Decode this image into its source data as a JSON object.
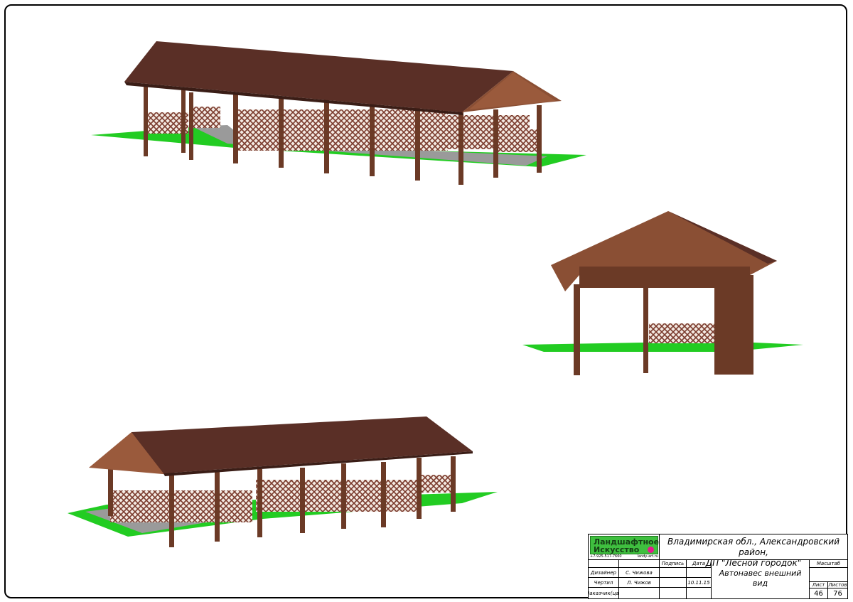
{
  "company": {
    "logo_line1": "Ландшафтное",
    "logo_line2": "Искусство",
    "phone": "+7-925-517-7660",
    "site": "landy-art.ru"
  },
  "location": {
    "line1": "Владимирская обл., Александровский район,",
    "line2": "ДП \"Лесной городок\""
  },
  "drawing_title": {
    "line1": "Автонавес внешний",
    "line2": "вид"
  },
  "headers": {
    "signature": "Подпись",
    "date": "Дата",
    "scale": "Масштаб",
    "sheet": "Лист",
    "sheets": "Листов"
  },
  "rows": [
    {
      "role": "Дизайнер",
      "name": "С. Чижова",
      "date": ""
    },
    {
      "role": "Чертил",
      "name": "Л. Чижов",
      "date": "10.11.15"
    },
    {
      "role": "Заказчик(ца)",
      "name": "",
      "date": ""
    }
  ],
  "sheet_number": "46",
  "sheet_total": "76",
  "colors": {
    "roof": "#5a2f26",
    "wood": "#6b3a26",
    "lattice": "#7a3a2c",
    "grass": "#22cc22",
    "paving": "#9a9a9a"
  }
}
